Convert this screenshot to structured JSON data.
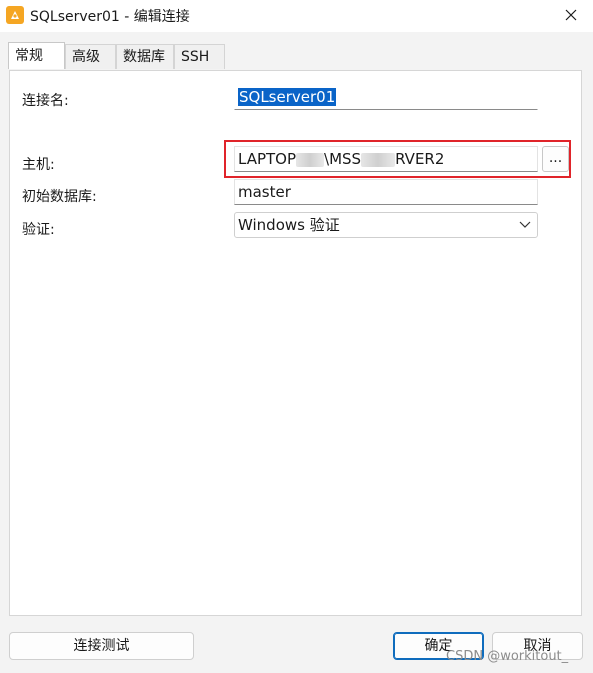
{
  "window": {
    "title": "SQLserver01 - 编辑连接",
    "close_label": "✕"
  },
  "tabs": [
    {
      "label": "常规",
      "active": true
    },
    {
      "label": "高级",
      "active": false
    },
    {
      "label": "数据库",
      "active": false
    },
    {
      "label": "SSH",
      "active": false
    }
  ],
  "form": {
    "connection_name_label": "连接名:",
    "connection_name_value": "SQLserver01",
    "host_label": "主机:",
    "host_value_part1": "LAPTOP",
    "host_value_part2": "\\MSS",
    "host_value_part3": "RVER2",
    "browse_label": "...",
    "initial_db_label": "初始数据库:",
    "initial_db_value": "master",
    "auth_label": "验证:",
    "auth_value": "Windows 验证"
  },
  "buttons": {
    "test": "连接测试",
    "ok": "确定",
    "cancel": "取消"
  },
  "watermark": "CSDN @workitout_",
  "colors": {
    "highlight": "#e0242a",
    "selection": "#0a64c8",
    "primary_border": "#0f6cbd"
  }
}
